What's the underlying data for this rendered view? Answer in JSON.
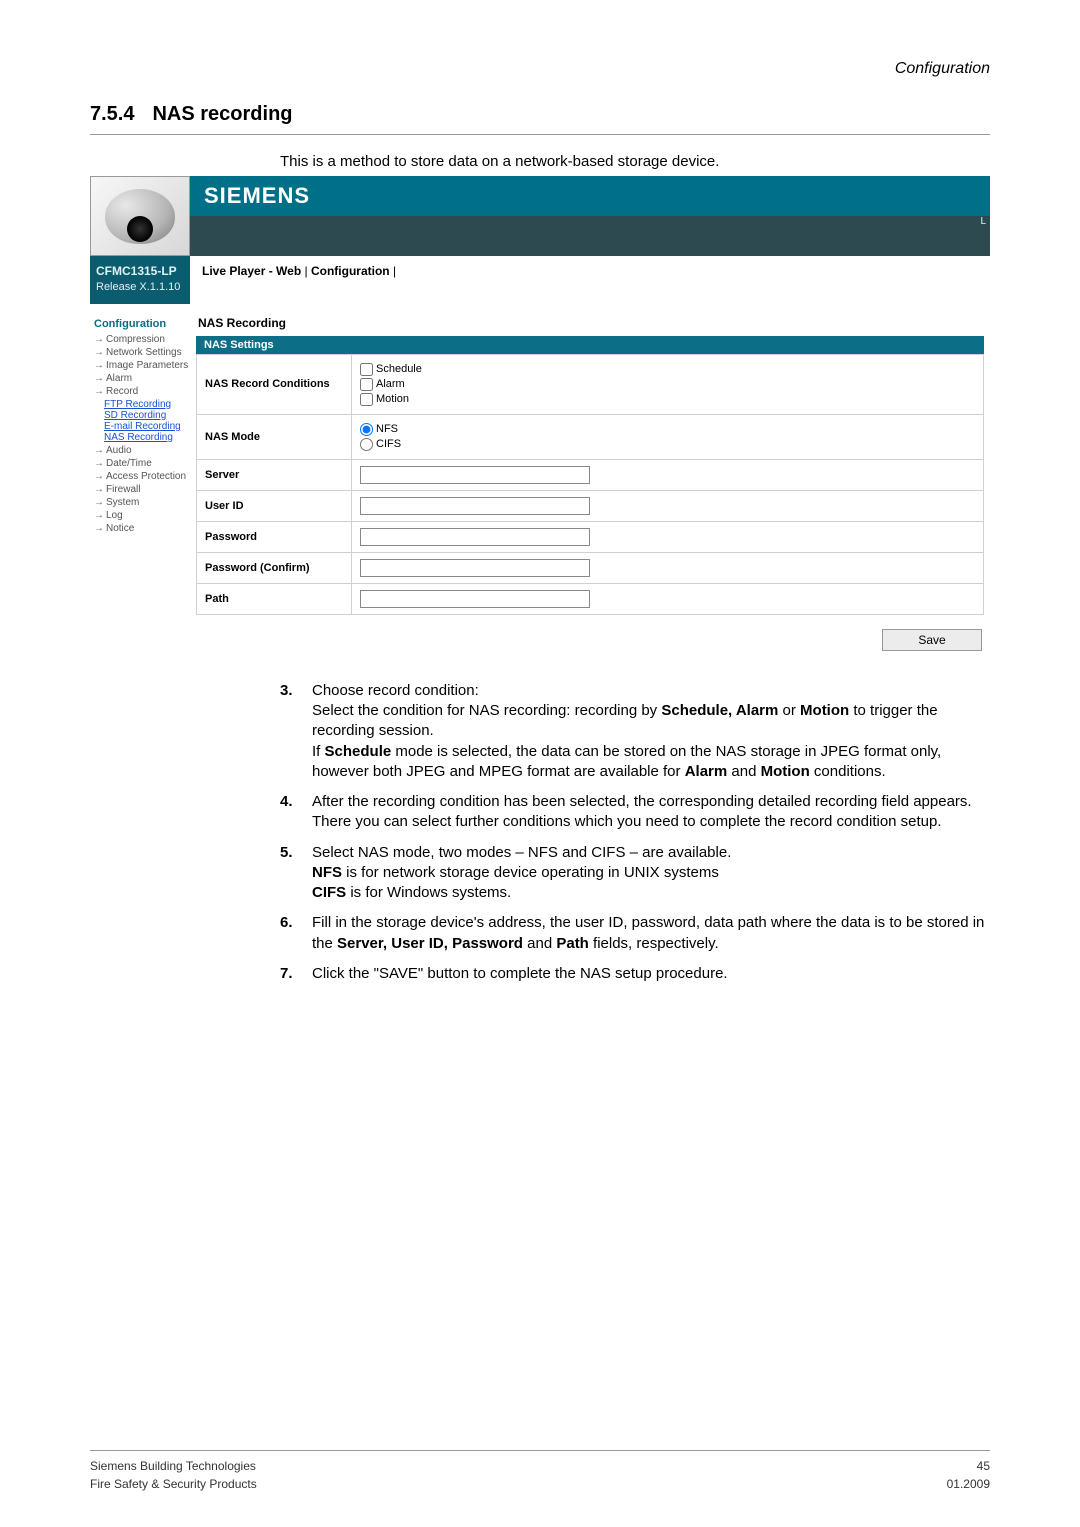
{
  "header": {
    "right": "Configuration"
  },
  "section": {
    "number": "7.5.4",
    "title": "NAS recording"
  },
  "intro": "This is a method to store data on a network-based storage device.",
  "brand": "SIEMENS",
  "model": {
    "name": "CFMC1315-LP",
    "release": "Release X.1.1.10"
  },
  "breadcrumb": {
    "a": "Live Player - Web",
    "sep": "|",
    "b": "Configuration",
    "sep2": "|"
  },
  "truncL": "L",
  "sidebar": {
    "title": "Configuration",
    "items": [
      "Compression",
      "Network Settings",
      "Image Parameters",
      "Alarm",
      "Record"
    ],
    "subitems": [
      "FTP Recording",
      "SD Recording",
      "E-mail Recording",
      "NAS Recording"
    ],
    "items2": [
      "Audio",
      "Date/Time",
      "Access Protection",
      "Firewall",
      "System",
      "Log",
      "Notice"
    ]
  },
  "content": {
    "title": "NAS Recording",
    "settingsBar": "NAS Settings",
    "rows": {
      "recordConditions": {
        "label": "NAS Record Conditions",
        "opts": {
          "schedule": "Schedule",
          "alarm": "Alarm",
          "motion": "Motion"
        }
      },
      "nasMode": {
        "label": "NAS Mode",
        "opts": {
          "nfs": "NFS",
          "cifs": "CIFS"
        }
      },
      "server": "Server",
      "userId": "User ID",
      "password": "Password",
      "passwordConfirm": "Password (Confirm)",
      "path": "Path"
    },
    "saveBtn": "Save"
  },
  "steps": {
    "s3": {
      "num": "3.",
      "t1": "Choose record condition:",
      "t2a": "Select the condition for NAS recording: recording by ",
      "t2b": "Schedule, Alarm",
      "t2c": " or ",
      "t2d": "Motion",
      "t2e": " to trigger the recording session.",
      "t3a": "If ",
      "t3b": "Schedule",
      "t3c": " mode is selected, the data can be stored on the NAS storage in JPEG format only, however both JPEG and MPEG format are available for ",
      "t3d": "Alarm",
      "t3e": " and ",
      "t3f": "Motion",
      "t3g": " conditions."
    },
    "s4": {
      "num": "4.",
      "text": "After the recording condition has been selected, the corresponding detailed recording field appears. There you can select further conditions which you need to complete the record condition setup."
    },
    "s5": {
      "num": "5.",
      "l1": "Select NAS mode, two modes – NFS and CIFS – are available.",
      "l2a": "NFS",
      "l2b": " is for network storage device operating in UNIX systems",
      "l3a": "CIFS",
      "l3b": " is for Windows systems."
    },
    "s6": {
      "num": "6.",
      "t1": "Fill in the storage device's address, the user ID, password, data path where the data is to be stored in the ",
      "t2": "Server, User ID, Password",
      "t3": " and ",
      "t4": "Path",
      "t5": " fields, respectively."
    },
    "s7": {
      "num": "7.",
      "text": "Click the \"SAVE\" button to complete the NAS setup procedure."
    }
  },
  "footer": {
    "pageNum": "45",
    "l1": "Siemens Building Technologies",
    "l2": "Fire Safety & Security Products",
    "date": "01.2009"
  }
}
